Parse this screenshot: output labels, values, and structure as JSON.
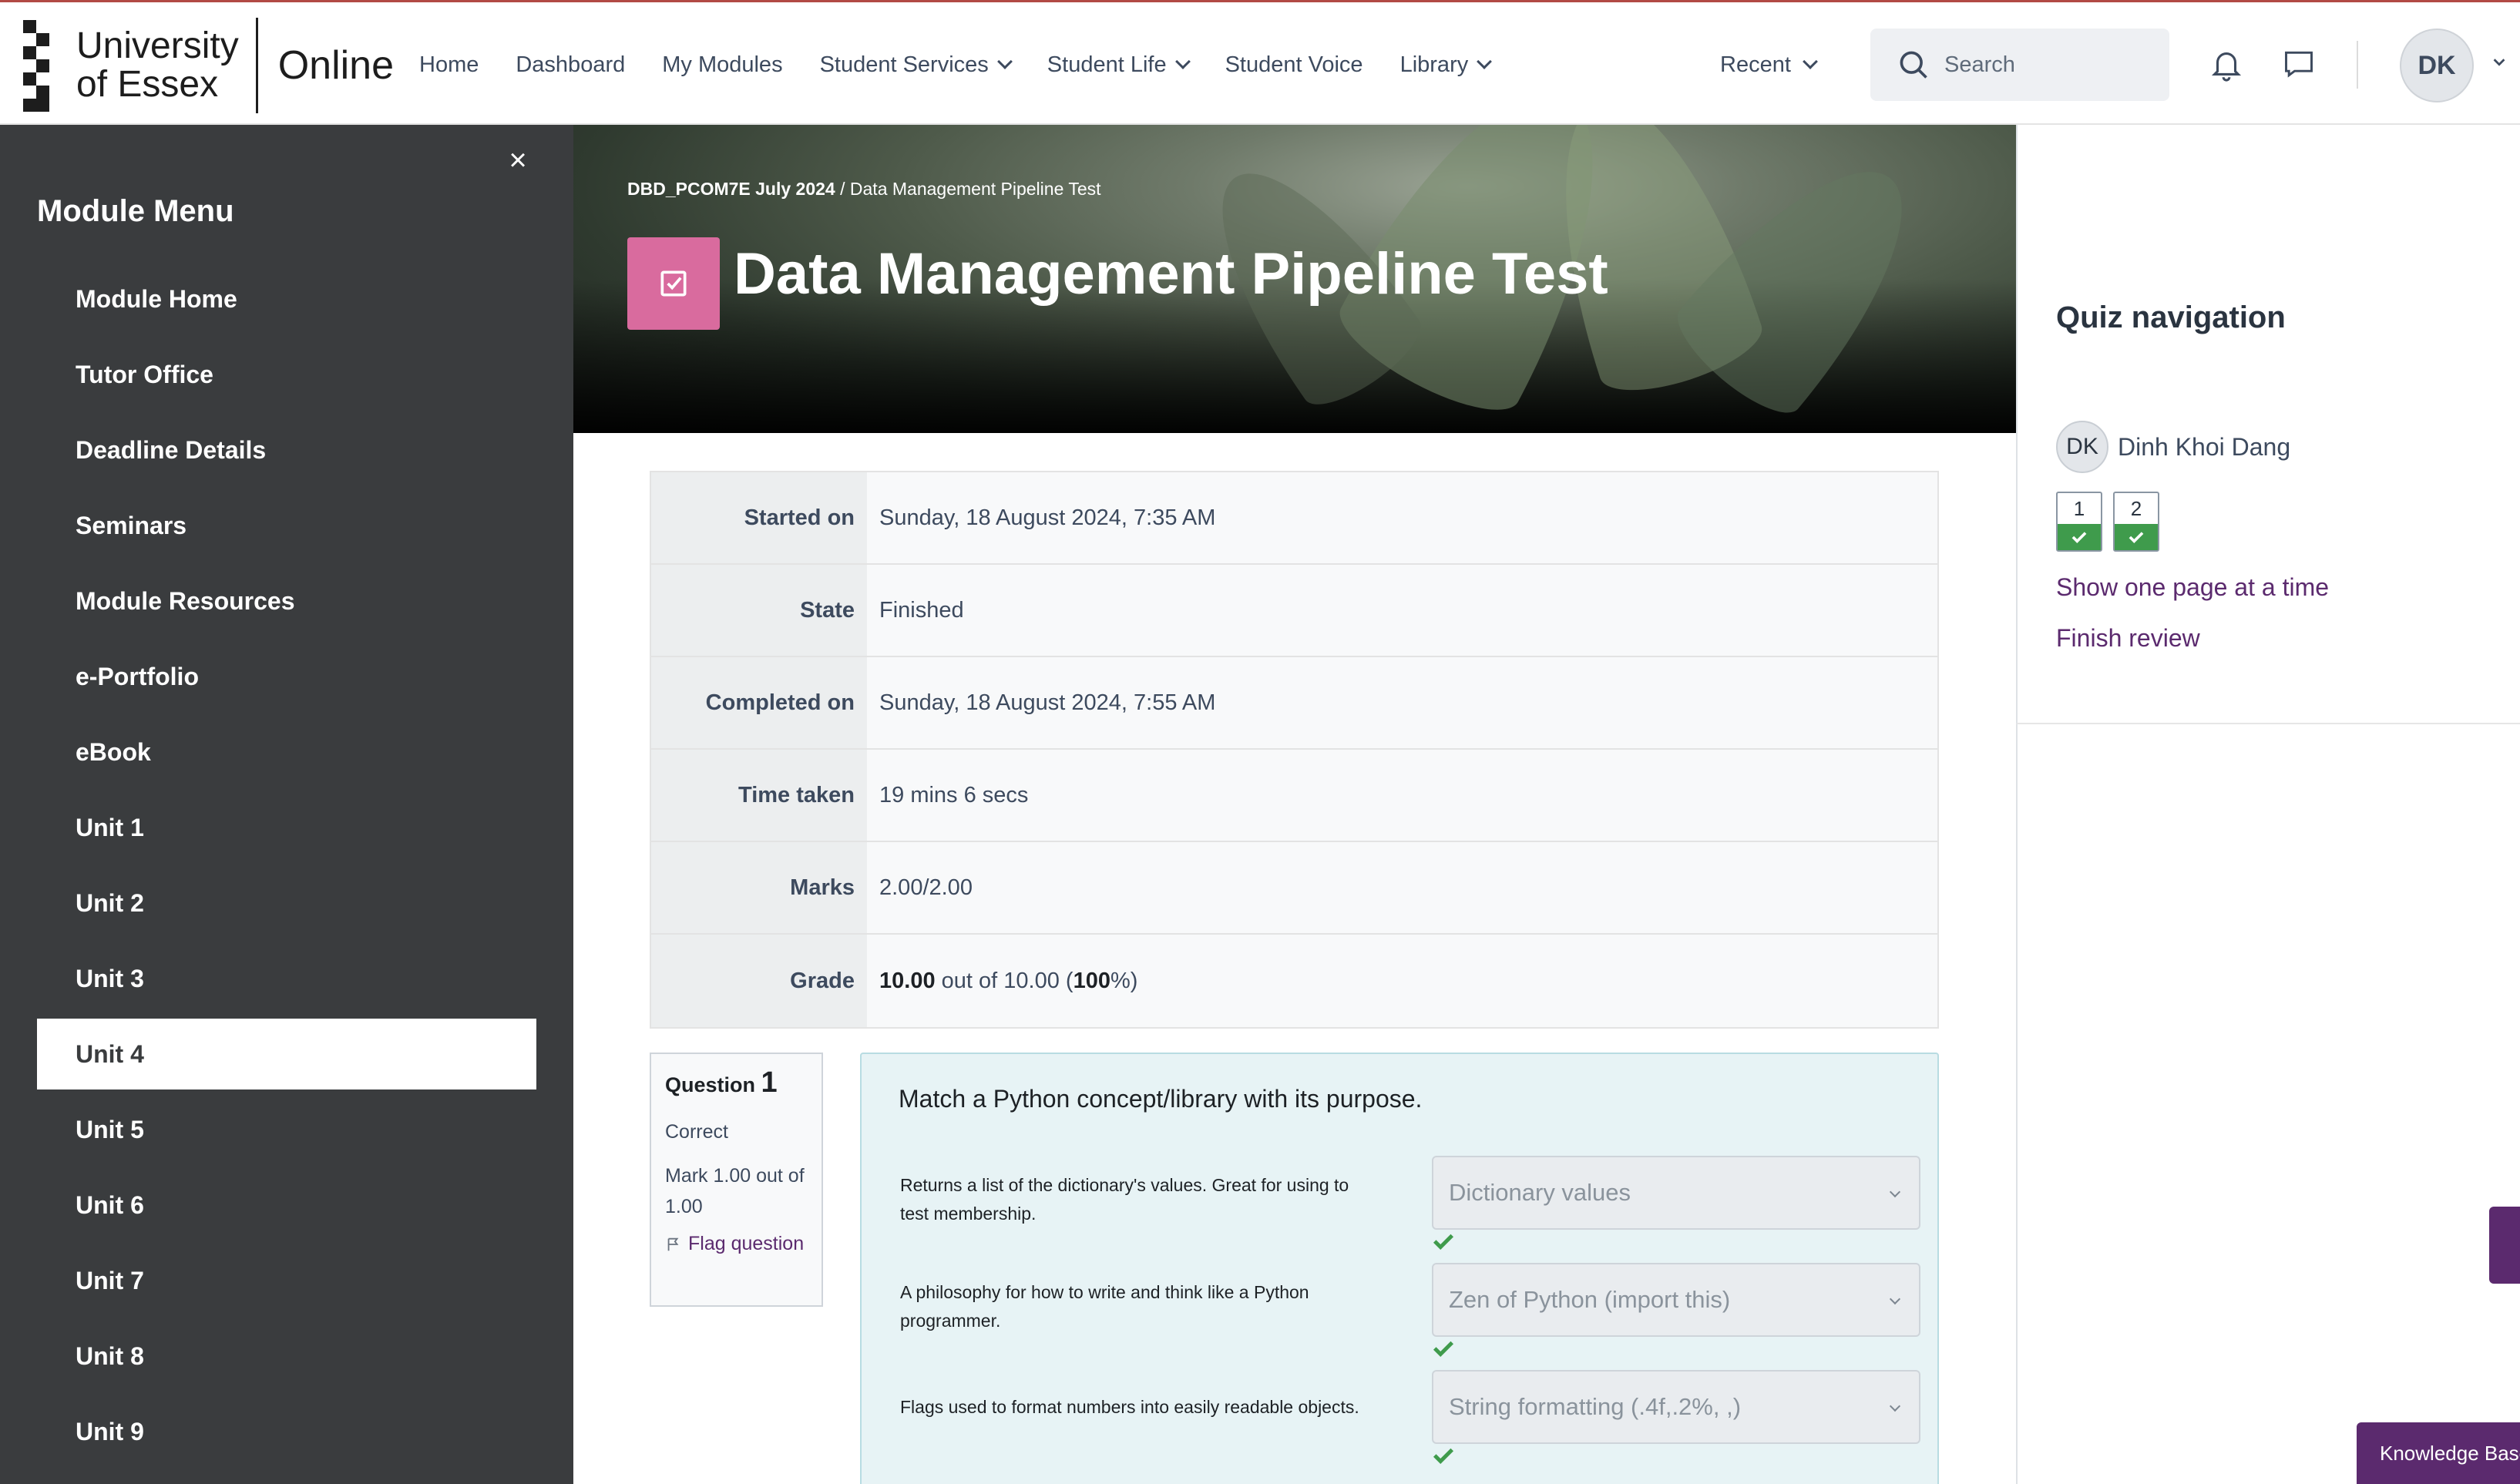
{
  "brand": {
    "logo_line1": "University",
    "logo_line2": "of Essex",
    "logo_suffix": "Online"
  },
  "nav": {
    "items": [
      {
        "label": "Home",
        "dropdown": false
      },
      {
        "label": "Dashboard",
        "dropdown": false
      },
      {
        "label": "My Modules",
        "dropdown": false
      },
      {
        "label": "Student Services",
        "dropdown": true
      },
      {
        "label": "Student Life",
        "dropdown": true
      },
      {
        "label": "Student Voice",
        "dropdown": false
      },
      {
        "label": "Library",
        "dropdown": true
      }
    ],
    "recent_label": "Recent",
    "search_placeholder": "Search",
    "avatar_initials": "DK"
  },
  "sidebar": {
    "title": "Module Menu",
    "items": [
      {
        "label": "Module Home",
        "active": false
      },
      {
        "label": "Tutor Office",
        "active": false
      },
      {
        "label": "Deadline Details",
        "active": false
      },
      {
        "label": "Seminars",
        "active": false
      },
      {
        "label": "Module Resources",
        "active": false
      },
      {
        "label": "e-Portfolio",
        "active": false
      },
      {
        "label": "eBook",
        "active": false
      },
      {
        "label": "Unit 1",
        "active": false
      },
      {
        "label": "Unit 2",
        "active": false
      },
      {
        "label": "Unit 3",
        "active": false
      },
      {
        "label": "Unit 4",
        "active": true
      },
      {
        "label": "Unit 5",
        "active": false
      },
      {
        "label": "Unit 6",
        "active": false
      },
      {
        "label": "Unit 7",
        "active": false
      },
      {
        "label": "Unit 8",
        "active": false
      },
      {
        "label": "Unit 9",
        "active": false
      }
    ]
  },
  "header": {
    "breadcrumb_course": "DBD_PCOM7E July 2024",
    "breadcrumb_sep": "/",
    "breadcrumb_page": "Data Management Pipeline Test",
    "title": "Data Management Pipeline Test",
    "icon_color": "#d96b9e"
  },
  "summary": {
    "rows": [
      {
        "key": "Started on",
        "value": "Sunday, 18 August 2024, 7:35 AM"
      },
      {
        "key": "State",
        "value": "Finished"
      },
      {
        "key": "Completed on",
        "value": "Sunday, 18 August 2024, 7:55 AM"
      },
      {
        "key": "Time taken",
        "value": "19 mins 6 secs"
      },
      {
        "key": "Marks",
        "value": "2.00/2.00"
      }
    ],
    "grade": {
      "key": "Grade",
      "score": "10.00",
      "out_of": "out of 10.00",
      "open": "(",
      "percent": "100",
      "close": "%)"
    }
  },
  "quiz_nav": {
    "title": "Quiz navigation",
    "user_initials": "DK",
    "user_name": "Dinh Khoi Dang",
    "questions": [
      {
        "number": "1",
        "status": "correct"
      },
      {
        "number": "2",
        "status": "correct"
      }
    ],
    "show_one_page": "Show one page at a time",
    "finish_review": "Finish review"
  },
  "question": {
    "label": "Question",
    "number": "1",
    "state": "Correct",
    "mark": "Mark 1.00 out of 1.00",
    "flag": "Flag question",
    "text": "Match a Python concept/library with its purpose.",
    "matches": [
      {
        "prompt": "Returns a list of the dictionary's values. Great for using to test membership.",
        "answer": "Dictionary values"
      },
      {
        "prompt": "A philosophy for how to write and think like a Python programmer.",
        "answer": "Zen of Python (import this)"
      },
      {
        "prompt": "Flags used to format numbers into easily readable objects.",
        "answer": "String formatting (.4f,.2%, ,)"
      }
    ]
  },
  "colors": {
    "accent": "#5b2a6e",
    "sidebar_bg": "#3a3c3e",
    "correct": "#3f9b4c"
  },
  "floating": {
    "knowledge_base": "Knowledge Base"
  }
}
